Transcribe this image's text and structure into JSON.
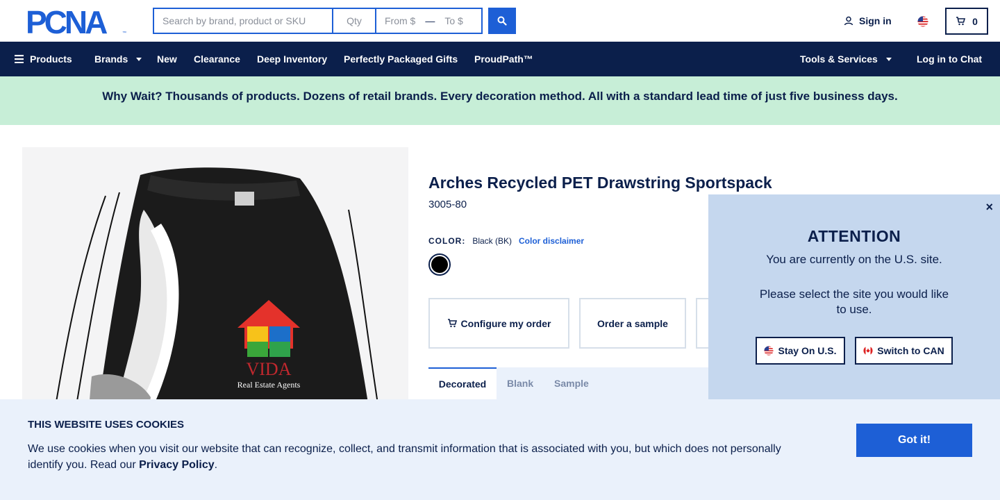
{
  "header": {
    "logo_text": "PCNA",
    "search": {
      "placeholder": "Search by brand, product or SKU",
      "qty_placeholder": "Qty",
      "from_placeholder": "From $",
      "to_placeholder": "To $"
    },
    "signin_label": "Sign in",
    "cart_count": "0",
    "search_icon": "search-icon",
    "user_icon": "user-icon",
    "cart_icon": "cart-icon",
    "flag_icon": "us-flag-icon"
  },
  "nav": {
    "products_label": "Products",
    "items": [
      {
        "label": "Brands"
      },
      {
        "label": "New"
      },
      {
        "label": "Clearance"
      },
      {
        "label": "Deep Inventory"
      },
      {
        "label": "Perfectly Packaged Gifts"
      },
      {
        "label": "ProudPath™"
      }
    ],
    "tools_label": "Tools & Services",
    "chat_label": "Log in to Chat"
  },
  "promo": {
    "text": "Why Wait? Thousands of products. Dozens of retail brands. Every decoration method. All with a standard lead time of just five business days."
  },
  "product": {
    "title": "Arches Recycled PET Drawstring Sportspack",
    "sku": "3005-80",
    "color_label": "COLOR:",
    "color_value": "Black (BK)",
    "color_disclaimer": "Color disclaimer",
    "actions": {
      "configure": "Configure my order",
      "sample": "Order a sample"
    },
    "tabs": [
      {
        "label": "Decorated"
      },
      {
        "label": "Blank"
      },
      {
        "label": "Sample"
      }
    ],
    "image_logo_text": "VIDA",
    "image_logo_sub": "Real Estate Agents"
  },
  "attention": {
    "title": "ATTENTION",
    "line1": "You are currently on the U.S. site.",
    "line2": "Please select the site you would like to use.",
    "stay_label": "Stay On U.S.",
    "switch_label": "Switch to CAN",
    "close": "×"
  },
  "cookie": {
    "title": "THIS WEBSITE USES COOKIES",
    "text": "We use cookies when you visit our website that can recognize, collect, and transmit information that is associated with you, but which does not personally identify you. Read our ",
    "link": "Privacy Policy",
    "end": ".",
    "button": "Got it!"
  },
  "colors": {
    "navy": "#0b1f4b",
    "blue": "#1d5fd6",
    "promo_green": "#c7eed7",
    "light_blue": "#eaf1fb",
    "modal_blue": "#c5d7ee"
  }
}
